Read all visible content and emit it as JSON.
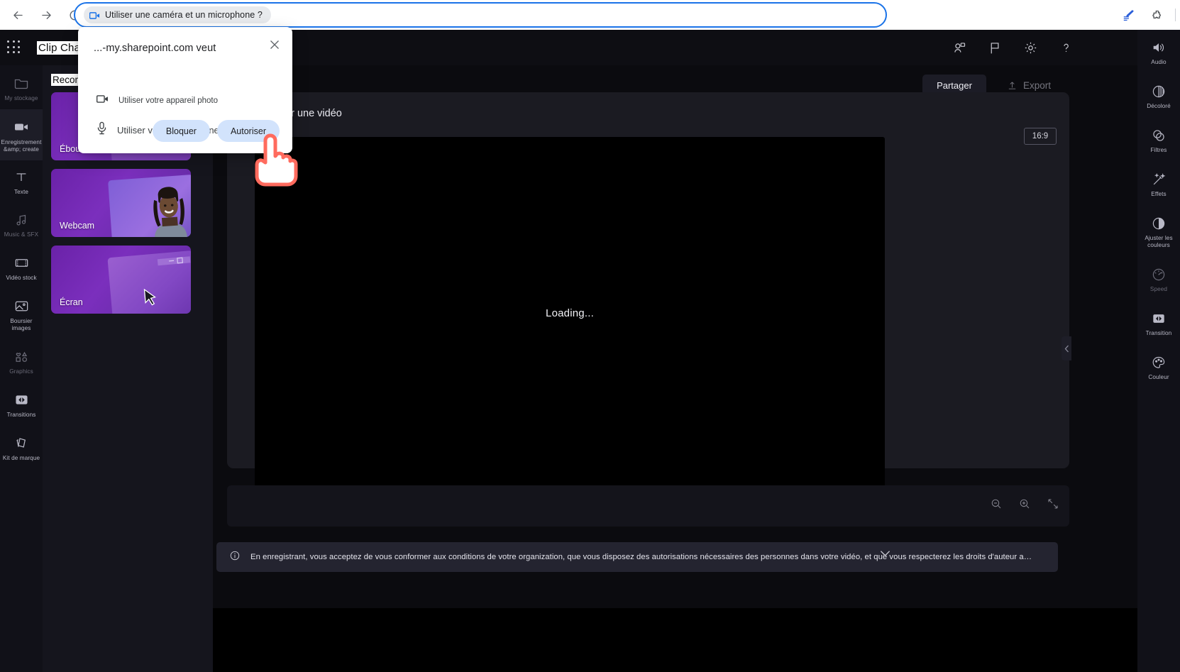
{
  "browser": {
    "back_icon": "arrow-left-icon",
    "forward_icon": "arrow-right-icon",
    "reload_icon": "reload-icon",
    "omnibox_chip_label": "Utiliser une caméra et un microphone ?",
    "omnibox_chip_icon": "camera-blocked-icon",
    "extension_icons": [
      "pen-extension-icon",
      "puzzle-extension-icon"
    ],
    "accent_blue": "#1a73e8"
  },
  "permission_dialog": {
    "title": "...-my.sharepoint.com veut",
    "close_label": "✕",
    "items": [
      {
        "icon": "camera-icon",
        "label": "Utiliser votre appareil photo"
      },
      {
        "icon": "microphone-icon",
        "label": "Utiliser votre microphone"
      }
    ],
    "block_label": "Bloquer",
    "allow_label": "Autoriser",
    "button_bg": "#d2e3fc"
  },
  "app_header": {
    "waffle_icon": "app-launcher-icon",
    "product_name": "Clip Champ",
    "icons": [
      {
        "name": "collaborate-icon"
      },
      {
        "name": "flag-feedback-icon"
      },
      {
        "name": "gear-settings-icon"
      },
      {
        "name": "help-question-icon"
      }
    ]
  },
  "left_rail": {
    "items": [
      {
        "label": "My  stockage",
        "icon": "folder-icon",
        "state": "dim"
      },
      {
        "label": "Enregistrement &amp; create",
        "icon": "video-camera-icon",
        "state": "active"
      },
      {
        "label": "Texte",
        "icon": "text-icon",
        "state": "normal"
      },
      {
        "label": "Music & SFX",
        "icon": "music-note-icon",
        "state": "dim"
      },
      {
        "label": "Vidéo stock",
        "icon": "film-strip-icon",
        "state": "normal"
      },
      {
        "label": "Boursier images",
        "icon": "image-icon",
        "state": "normal"
      },
      {
        "label": "Graphics",
        "icon": "shapes-icon",
        "state": "dim"
      },
      {
        "label": "Transitions",
        "icon": "transition-icon",
        "state": "normal"
      },
      {
        "label": "Kit de marque",
        "icon": "brand-kit-icon",
        "state": "normal"
      }
    ]
  },
  "recorder_panel": {
    "title": "Recorder",
    "collapse_icon": "chevron-left-icon",
    "cards": [
      {
        "label": "Éboulis",
        "art": "gallery"
      },
      {
        "label": "Webcam",
        "art": "webcam"
      },
      {
        "label": "Écran",
        "art": "screen"
      }
    ]
  },
  "stage": {
    "panel_title": "Enregistrer une vidéo",
    "aspect_ratio": "16:9",
    "loading_text": "Loading...",
    "share_label": "Partager",
    "export_label": "Export",
    "export_icon": "upload-icon",
    "collapse_icon": "chevron-left-icon",
    "timeline_tools": [
      {
        "name": "zoom-out-icon"
      },
      {
        "name": "zoom-in-icon"
      },
      {
        "name": "fit-to-screen-icon"
      }
    ],
    "notice": {
      "icon": "info-icon",
      "text": "En enregistrant, vous acceptez de vous conformer aux conditions de votre organization, que vous disposez des autorisations nécessaires des personnes dans votre vidéo, et que vous respecterez les droits d'auteur a…",
      "expand_icon": "chevron-down-icon"
    }
  },
  "right_rail": {
    "items": [
      {
        "label": "Audio",
        "icon": "speaker-icon"
      },
      {
        "label": "Décoloré",
        "icon": "fade-icon"
      },
      {
        "label": "Filtres",
        "icon": "filters-icon"
      },
      {
        "label": "Effets",
        "icon": "magic-wand-icon"
      },
      {
        "label": "Ajuster les couleurs",
        "icon": "contrast-icon"
      },
      {
        "label": "Speed",
        "icon": "speedometer-icon",
        "state": "dim"
      },
      {
        "label": "Transition",
        "icon": "transition-icon"
      },
      {
        "label": "Couleur",
        "icon": "palette-icon"
      }
    ]
  }
}
